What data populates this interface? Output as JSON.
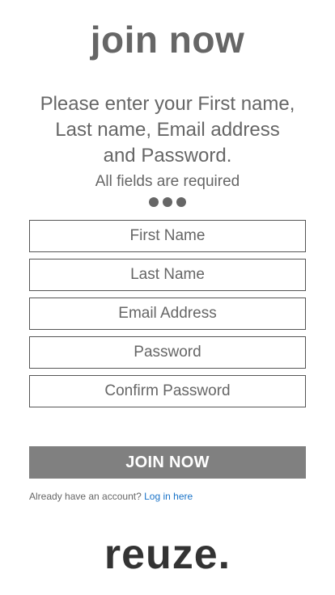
{
  "header": {
    "title": "join now"
  },
  "intro": {
    "line1": "Please enter your First name,",
    "line2": "Last name, Email address",
    "line3": "and Password.",
    "required_note": "All fields are required"
  },
  "form": {
    "first_name": {
      "placeholder": "First Name",
      "value": ""
    },
    "last_name": {
      "placeholder": "Last Name",
      "value": ""
    },
    "email": {
      "placeholder": "Email Address",
      "value": ""
    },
    "password": {
      "placeholder": "Password",
      "value": ""
    },
    "confirm_password": {
      "placeholder": "Confirm Password",
      "value": ""
    },
    "submit_label": "JOIN NOW"
  },
  "login": {
    "prompt": "Already have an account?",
    "link_label": "Log in here"
  },
  "brand": {
    "logo_text": "reuze."
  },
  "colors": {
    "text": "#666666",
    "button_bg": "#808080",
    "link": "#1a73c8",
    "logo": "#333333"
  }
}
